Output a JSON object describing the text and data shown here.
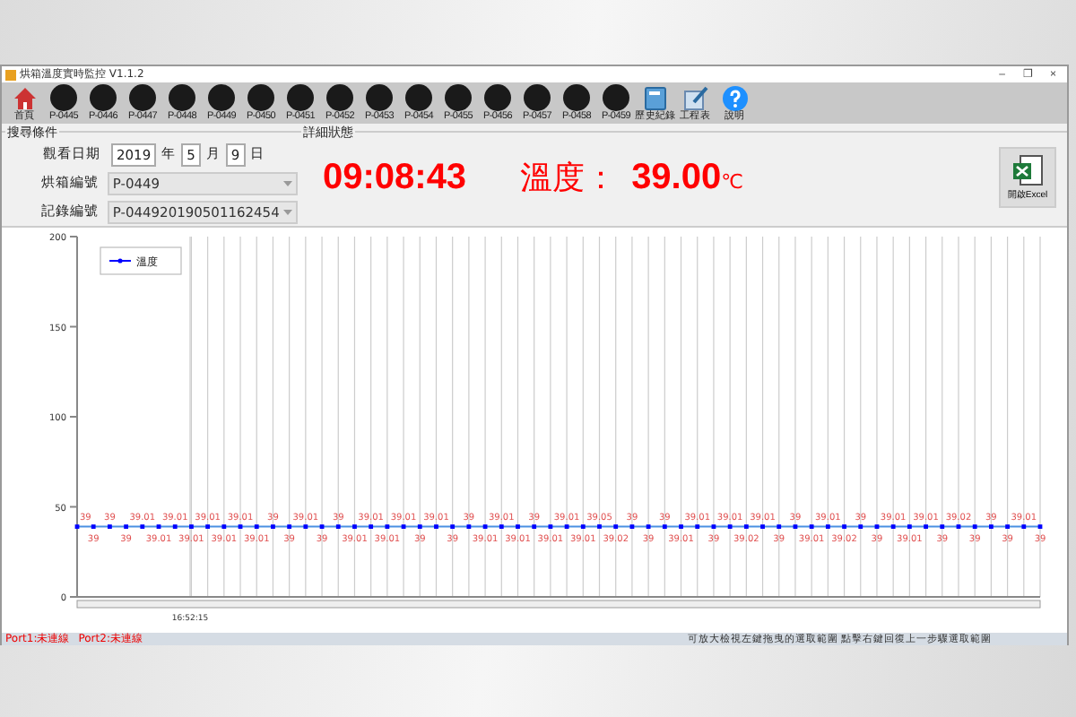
{
  "window": {
    "title": "烘箱溫度實時監控 V1.1.2",
    "controls": [
      "–",
      "❐",
      "×"
    ]
  },
  "toolbar": [
    {
      "kind": "home",
      "label": "首頁"
    },
    {
      "kind": "oven",
      "label": "P-0445"
    },
    {
      "kind": "oven",
      "label": "P-0446"
    },
    {
      "kind": "oven",
      "label": "P-0447"
    },
    {
      "kind": "oven",
      "label": "P-0448"
    },
    {
      "kind": "oven",
      "label": "P-0449"
    },
    {
      "kind": "oven",
      "label": "P-0450"
    },
    {
      "kind": "oven",
      "label": "P-0451"
    },
    {
      "kind": "oven",
      "label": "P-0452"
    },
    {
      "kind": "oven",
      "label": "P-0453"
    },
    {
      "kind": "oven",
      "label": "P-0454"
    },
    {
      "kind": "oven",
      "label": "P-0455"
    },
    {
      "kind": "oven",
      "label": "P-0456"
    },
    {
      "kind": "oven",
      "label": "P-0457"
    },
    {
      "kind": "oven",
      "label": "P-0458"
    },
    {
      "kind": "oven",
      "label": "P-0459"
    },
    {
      "kind": "history",
      "label": "歷史紀錄"
    },
    {
      "kind": "schedule",
      "label": "工程表"
    },
    {
      "kind": "help",
      "label": "說明"
    }
  ],
  "search": {
    "title": "搜尋條件",
    "date": {
      "label": "觀看日期",
      "year": "2019",
      "year_unit": "年",
      "month": "5",
      "month_unit": "月",
      "day": "9",
      "day_unit": "日"
    },
    "oven": {
      "label": "烘箱編號",
      "value": "P-0449"
    },
    "record": {
      "label": "記錄編號",
      "value": "P-044920190501162454"
    }
  },
  "detail": {
    "title": "詳細狀態",
    "time": "09:08:43",
    "temp_label": "溫度：",
    "temp_value": "39.00",
    "temp_unit": "℃",
    "excel_button": "開啟Excel"
  },
  "chart": {
    "time_label": "16:52:15",
    "chart_data": {
      "type": "line",
      "grid": true,
      "ylim": [
        0,
        200
      ],
      "yticks": [
        0,
        50,
        100,
        150,
        200
      ],
      "data_labels": true,
      "series": [
        {
          "name": "溫度",
          "color": "#0000ff",
          "marker": "square",
          "values": [
            39,
            39,
            39,
            39,
            39.01,
            39.01,
            39.01,
            39.01,
            39.01,
            39.01,
            39.01,
            39.01,
            39,
            39,
            39.01,
            39,
            39,
            39.01,
            39.01,
            39.01,
            39.01,
            39,
            39.01,
            39,
            39,
            39.01,
            39.01,
            39.01,
            39,
            39.01,
            39.01,
            39.01,
            39.05,
            39.02,
            39,
            39,
            39,
            39.01,
            39.01,
            39,
            39.01,
            39.02,
            39.01,
            39,
            39,
            39.01,
            39.01,
            39.02,
            39,
            39,
            39.01,
            39.01,
            39.01,
            39,
            39.02,
            39,
            39,
            39,
            39.01,
            39
          ]
        }
      ]
    }
  },
  "status_bar": {
    "ports": [
      "Port1:未連線",
      "Port2:未連線"
    ],
    "hint": "可放大檢視左鍵拖曳的選取範圍 點擊右鍵回復上一步驟選取範圍"
  }
}
